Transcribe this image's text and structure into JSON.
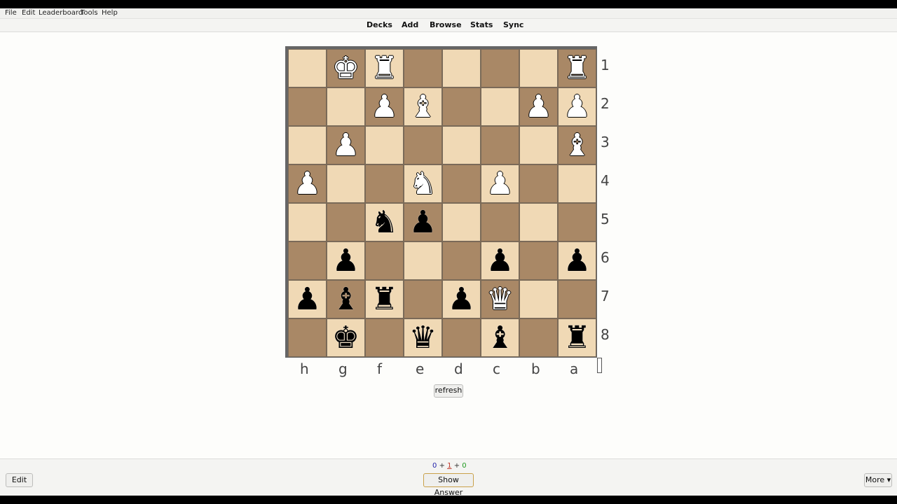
{
  "menu": {
    "file": "File",
    "edit": "Edit",
    "leaderboard": "Leaderboard",
    "tools": "Tools",
    "help": "Help"
  },
  "toolbar": {
    "decks": "Decks",
    "add": "Add",
    "browse": "Browse",
    "stats": "Stats",
    "sync": "Sync"
  },
  "board": {
    "rank_labels": [
      "1",
      "2",
      "3",
      "4",
      "5",
      "6",
      "7",
      "8"
    ],
    "file_labels": [
      "h",
      "g",
      "f",
      "e",
      "d",
      "c",
      "b",
      "a"
    ],
    "rows": [
      [
        "",
        "wK",
        "wR",
        "",
        "",
        "",
        "",
        "wR"
      ],
      [
        "",
        "",
        "wP",
        "wB",
        "",
        "",
        "wP",
        "wP"
      ],
      [
        "",
        "wP",
        "",
        "",
        "",
        "",
        "",
        "wB"
      ],
      [
        "wP",
        "",
        "",
        "wN",
        "",
        "wP",
        "",
        ""
      ],
      [
        "",
        "",
        "bN",
        "bP",
        "",
        "",
        "",
        ""
      ],
      [
        "",
        "bP",
        "",
        "",
        "",
        "bP",
        "",
        "bP"
      ],
      [
        "bP",
        "bB",
        "bR",
        "",
        "bP",
        "wQ",
        "",
        ""
      ],
      [
        "",
        "bK",
        "",
        "bQ",
        "",
        "bB",
        "",
        "bR"
      ]
    ]
  },
  "refresh_label": "refresh",
  "counts": {
    "new": "0",
    "plus1": "+",
    "learning": "1",
    "plus2": "+",
    "review": "0"
  },
  "bottom": {
    "edit_label": "Edit",
    "show_answer_label": "Show Answer",
    "more_label": "More ▾"
  }
}
